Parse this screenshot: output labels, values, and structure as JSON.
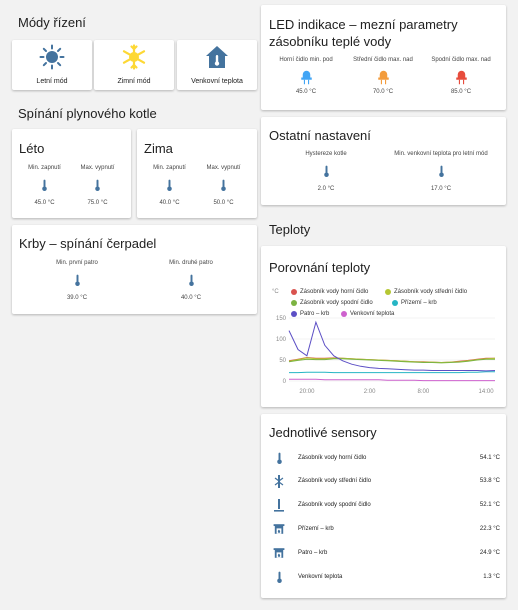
{
  "modes": {
    "title": "Módy řízení",
    "buttons": [
      {
        "label": "Letní mód",
        "icon": "sun-icon"
      },
      {
        "label": "Zimní mód",
        "icon": "snowflake-icon"
      },
      {
        "label": "Venkovní teplota",
        "icon": "house-icon"
      }
    ]
  },
  "gas": {
    "title": "Spínání plynového kotle",
    "summer": {
      "title": "Léto",
      "items": [
        {
          "label": "Min. zapnutí",
          "value": "45.0 °C"
        },
        {
          "label": "Max. vypnutí",
          "value": "75.0 °C"
        }
      ]
    },
    "winter": {
      "title": "Zima",
      "items": [
        {
          "label": "Min. zapnutí",
          "value": "40.0 °C"
        },
        {
          "label": "Max. vypnutí",
          "value": "50.0 °C"
        }
      ]
    }
  },
  "fireplace": {
    "title": "Krby – spínání čerpadel",
    "items": [
      {
        "label": "Min. první patro",
        "value": "39.0 °C"
      },
      {
        "label": "Min. druhé patro",
        "value": "40.0 °C"
      }
    ]
  },
  "led": {
    "title": "LED indikace – mezní parametry zásobníku teplé vody",
    "items": [
      {
        "label": "Horní čidlo min. pod",
        "value": "45.0 °C",
        "color": "#42a5f5"
      },
      {
        "label": "Střední čidlo max. nad",
        "value": "70.0 °C",
        "color": "#f39c3c"
      },
      {
        "label": "Spodní čidlo max. nad",
        "value": "85.0 °C",
        "color": "#e74c3c"
      }
    ]
  },
  "other": {
    "title": "Ostatní nastavení",
    "items": [
      {
        "label": "Hystereze kotle",
        "value": "2.0 °C"
      },
      {
        "label": "Min. venkovní teplota pro letní mód",
        "value": "17.0 °C"
      }
    ]
  },
  "temps": {
    "title": "Teploty",
    "chart_card_title": "Porovnání teploty"
  },
  "chart_data": {
    "type": "line",
    "title": "Porovnání teploty",
    "ylabel": "°C",
    "ylim": [
      0,
      150
    ],
    "yticks": [
      "150",
      "100",
      "50",
      "0"
    ],
    "xticks": [
      "20:00",
      "2:00",
      "8:00",
      "14:00"
    ],
    "x": [
      0,
      1,
      2,
      3,
      4,
      5,
      6,
      7,
      8,
      9,
      10,
      11,
      12,
      13,
      14,
      15,
      16,
      17,
      18,
      19,
      20,
      21,
      22,
      23
    ],
    "series": [
      {
        "name": "Zásobník vody horní čidlo",
        "color": "#d9534f",
        "values": [
          48,
          52,
          56,
          54,
          54,
          55,
          54,
          53,
          52,
          51,
          50,
          49,
          48,
          47,
          46,
          46,
          45,
          44,
          45,
          47,
          49,
          52,
          54,
          54
        ]
      },
      {
        "name": "Zásobník vody střední čidlo",
        "color": "#b5c733",
        "values": [
          47,
          51,
          55,
          53,
          53,
          54,
          54,
          53,
          52,
          51,
          50,
          49,
          48,
          47,
          46,
          45,
          45,
          44,
          45,
          46,
          48,
          51,
          53,
          54
        ]
      },
      {
        "name": "Zásobník vody spodní čidlo",
        "color": "#7cb342",
        "values": [
          46,
          49,
          52,
          51,
          51,
          53,
          53,
          52,
          51,
          50,
          49,
          48,
          47,
          46,
          45,
          44,
          44,
          43,
          44,
          45,
          47,
          50,
          52,
          52
        ]
      },
      {
        "name": "Přízemí – krb",
        "color": "#26b5c4",
        "values": [
          20,
          20,
          21,
          21,
          21,
          20,
          20,
          20,
          20,
          20,
          20,
          20,
          20,
          20,
          20,
          20,
          20,
          20,
          20,
          20,
          21,
          21,
          22,
          22
        ]
      },
      {
        "name": "Patro – krb",
        "color": "#5c4fc5",
        "values": [
          120,
          75,
          60,
          140,
          85,
          60,
          48,
          40,
          35,
          32,
          30,
          29,
          28,
          27,
          26,
          26,
          25,
          25,
          25,
          25,
          25,
          25,
          24,
          25
        ]
      },
      {
        "name": "Venkovní teplota",
        "color": "#ce62ce",
        "values": [
          4,
          4,
          4,
          4,
          3,
          3,
          3,
          3,
          3,
          3,
          3,
          2,
          2,
          2,
          2,
          1,
          1,
          1,
          1,
          1,
          1,
          1,
          1,
          1
        ]
      }
    ]
  },
  "sensors": {
    "title": "Jednotlivé sensory",
    "rows": [
      {
        "name": "Zásobník vody horní čidlo",
        "value": "54.1 °C",
        "icon": "thermometer-icon"
      },
      {
        "name": "Zásobník vody střední čidlo",
        "value": "53.8 °C",
        "icon": "thermometer-middle-icon"
      },
      {
        "name": "Zásobník vody spodní čidlo",
        "value": "52.1 °C",
        "icon": "thermometer-low-icon"
      },
      {
        "name": "Přízemí – krb",
        "value": "22.3 °C",
        "icon": "fireplace-icon"
      },
      {
        "name": "Patro – krb",
        "value": "24.9 °C",
        "icon": "fireplace-icon"
      },
      {
        "name": "Venkovní teplota",
        "value": "1.3 °C",
        "icon": "thermometer-icon"
      }
    ]
  },
  "colors": {
    "accent": "#44739e",
    "sun": "#fdd835"
  }
}
